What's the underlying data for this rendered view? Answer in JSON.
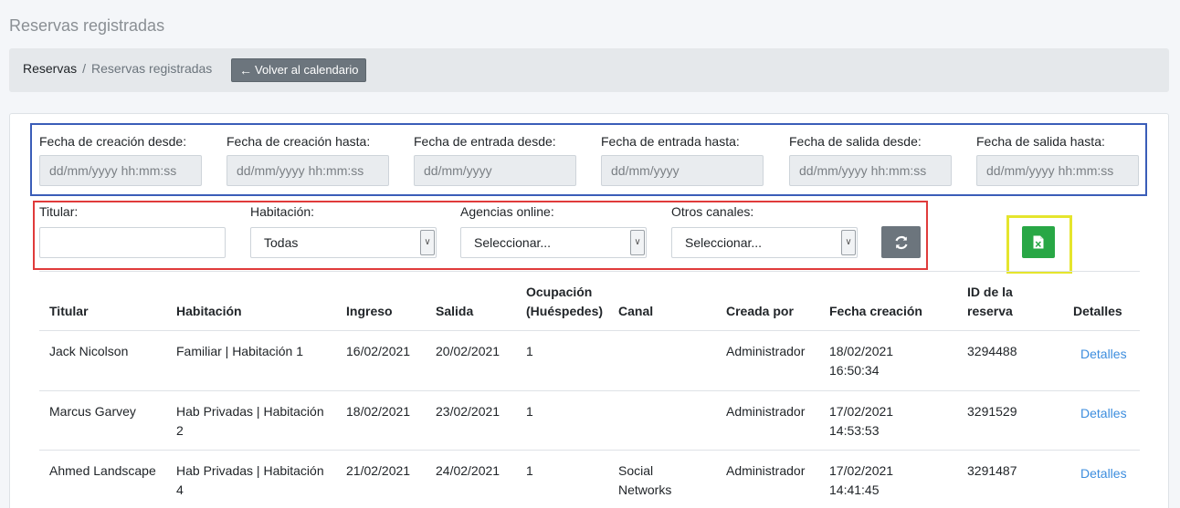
{
  "page": {
    "title": "Reservas registradas"
  },
  "breadcrumb": {
    "root": "Reservas",
    "separator": "/",
    "current": "Reservas registradas"
  },
  "back_button": {
    "label": "Volver al calendario",
    "icon": "arrow-left-icon"
  },
  "date_filters": [
    {
      "label": "Fecha de creación desde:",
      "placeholder": "dd/mm/yyyy hh:mm:ss"
    },
    {
      "label": "Fecha de creación hasta:",
      "placeholder": "dd/mm/yyyy hh:mm:ss"
    },
    {
      "label": "Fecha de entrada desde:",
      "placeholder": "dd/mm/yyyy"
    },
    {
      "label": "Fecha de entrada hasta:",
      "placeholder": "dd/mm/yyyy"
    },
    {
      "label": "Fecha de salida desde:",
      "placeholder": "dd/mm/yyyy hh:mm:ss"
    },
    {
      "label": "Fecha de salida hasta:",
      "placeholder": "dd/mm/yyyy hh:mm:ss"
    }
  ],
  "filters": {
    "titular": {
      "label": "Titular:",
      "value": ""
    },
    "habitacion": {
      "label": "Habitación:",
      "value": "Todas"
    },
    "agencias": {
      "label": "Agencias online:",
      "value": "Seleccionar..."
    },
    "otros": {
      "label": "Otros canales:",
      "value": "Seleccionar..."
    }
  },
  "actions": {
    "refresh_icon": "refresh-icon",
    "excel_icon": "excel-icon"
  },
  "colors": {
    "date_box": "#3a5db8",
    "filter_box": "#e03b3b",
    "excel_box": "#e5e52d",
    "excel": "#28a745",
    "link": "#3c8dde"
  },
  "table": {
    "headers": {
      "titular": "Titular",
      "habitacion": "Habitación",
      "ingreso": "Ingreso",
      "salida": "Salida",
      "ocupacion_1": "Ocupación",
      "ocupacion_2": "(Huéspedes)",
      "canal": "Canal",
      "creada_por": "Creada por",
      "fecha_creacion": "Fecha creación",
      "id_1": "ID de la",
      "id_2": "reserva",
      "detalles": "Detalles"
    },
    "rows": [
      {
        "titular": "Jack Nicolson",
        "habitacion_1": "Familiar | Habitación 1",
        "habitacion_2": "",
        "ingreso": "16/02/2021",
        "salida": "20/02/2021",
        "ocupacion": "1",
        "canal_1": "",
        "canal_2": "",
        "creada_por": "Administrador",
        "fecha_1": "18/02/2021",
        "fecha_2": "16:50:34",
        "id": "3294488",
        "detalles": "Detalles"
      },
      {
        "titular": "Marcus Garvey",
        "habitacion_1": "Hab Privadas | Habitación",
        "habitacion_2": "2",
        "ingreso": "18/02/2021",
        "salida": "23/02/2021",
        "ocupacion": "1",
        "canal_1": "",
        "canal_2": "",
        "creada_por": "Administrador",
        "fecha_1": "17/02/2021",
        "fecha_2": "14:53:53",
        "id": "3291529",
        "detalles": "Detalles"
      },
      {
        "titular": "Ahmed Landscape",
        "habitacion_1": "Hab Privadas | Habitación",
        "habitacion_2": "4",
        "ingreso": "21/02/2021",
        "salida": "24/02/2021",
        "ocupacion": "1",
        "canal_1": "Social",
        "canal_2": "Networks",
        "creada_por": "Administrador",
        "fecha_1": "17/02/2021",
        "fecha_2": "14:41:45",
        "id": "3291487",
        "detalles": "Detalles"
      }
    ]
  }
}
